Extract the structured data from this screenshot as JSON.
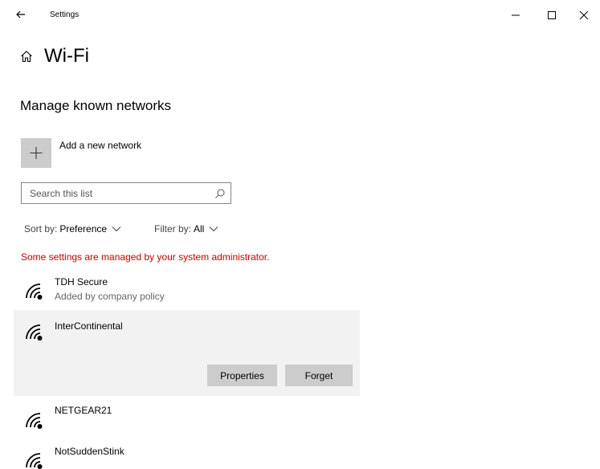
{
  "window": {
    "title": "Settings"
  },
  "header": {
    "page_title": "Wi-Fi",
    "section_title": "Manage known networks"
  },
  "add_network": {
    "label": "Add a new network"
  },
  "search": {
    "placeholder": "Search this list",
    "value": ""
  },
  "sort": {
    "label": "Sort by:",
    "value": "Preference"
  },
  "filter": {
    "label": "Filter by:",
    "value": "All"
  },
  "admin_message": "Some settings are managed by your system administrator.",
  "networks": [
    {
      "name": "TDH Secure",
      "subtitle": "Added by company policy"
    },
    {
      "name": "InterContinental",
      "subtitle": ""
    },
    {
      "name": "NETGEAR21",
      "subtitle": ""
    },
    {
      "name": "NotSuddenStink",
      "subtitle": ""
    }
  ],
  "selected_actions": {
    "properties_label": "Properties",
    "forget_label": "Forget"
  },
  "icons": {
    "back": "back-arrow-icon",
    "home": "home-icon",
    "add": "plus-icon",
    "search": "search-icon",
    "wifi": "wifi-icon",
    "chevron": "chevron-down-icon"
  },
  "colors": {
    "admin_warning": "#c50500",
    "selected_bg": "#f2f2f2",
    "button_bg": "#cccccc"
  }
}
